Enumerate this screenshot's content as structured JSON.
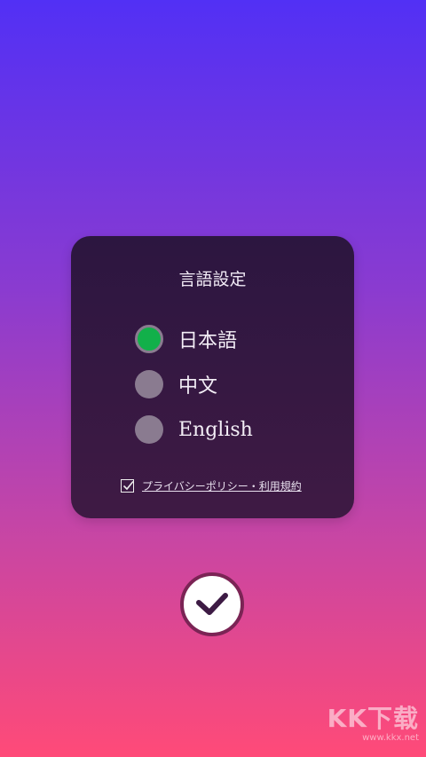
{
  "dialog": {
    "title": "言語設定",
    "options": [
      {
        "label": "日本語",
        "selected": true
      },
      {
        "label": "中文",
        "selected": false
      },
      {
        "label": "English",
        "selected": false
      }
    ],
    "consent": {
      "checked": true,
      "link_text": "プライバシーポリシー・利用規約"
    }
  },
  "confirm_button": {
    "icon": "checkmark-icon"
  },
  "watermark": {
    "text": "KK下载",
    "url_text": "www.kkx.net"
  },
  "colors": {
    "selected": "#12b04a",
    "unselected": "#8a7b90",
    "panel": "#2c1640",
    "button_border": "#7b2455"
  }
}
